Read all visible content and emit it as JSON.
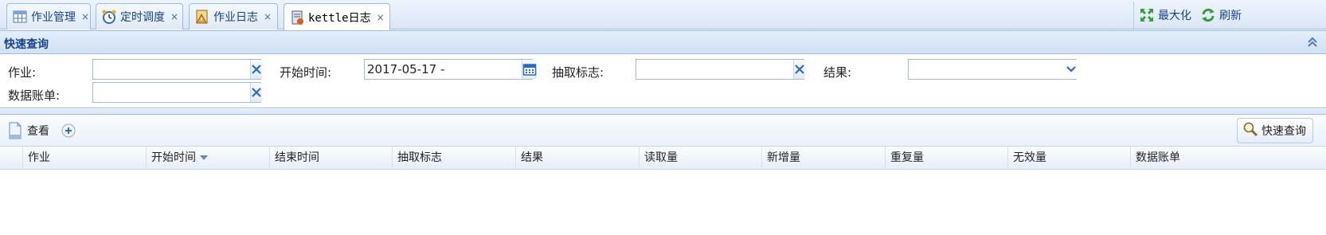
{
  "tabs": [
    {
      "label": "作业管理",
      "icon": "table-icon"
    },
    {
      "label": "定时调度",
      "icon": "alarm-clock-icon"
    },
    {
      "label": "作业日志",
      "icon": "log-icon"
    },
    {
      "label": "kettle日志",
      "icon": "notebook-icon",
      "active": true
    }
  ],
  "tab_close_glyph": "×",
  "toolbar": {
    "maximize_label": "最大化",
    "refresh_label": "刷新"
  },
  "quick_search": {
    "title": "快速查询",
    "fields": {
      "job_label": "作业:",
      "job_value": "",
      "start_time_label": "开始时间:",
      "start_time_value": "2017-05-17 -",
      "extract_flag_label": "抽取标志:",
      "extract_flag_value": "",
      "result_label": "结果:",
      "result_value": "",
      "data_bill_label": "数据账单:",
      "data_bill_value": ""
    },
    "clear_glyph": "✕"
  },
  "grid": {
    "toolbar": {
      "view_label": "查看",
      "quick_search_label": "快速查询"
    },
    "columns": [
      "作业",
      "开始时间",
      "结束时间",
      "抽取标志",
      "结果",
      "读取量",
      "新增量",
      "重复量",
      "无效量",
      "数据账单"
    ],
    "sort_column": "开始时间",
    "rows": []
  },
  "colors": {
    "accent": "#15428b",
    "border": "#99bbe8",
    "panel": "#dfe8f6"
  }
}
